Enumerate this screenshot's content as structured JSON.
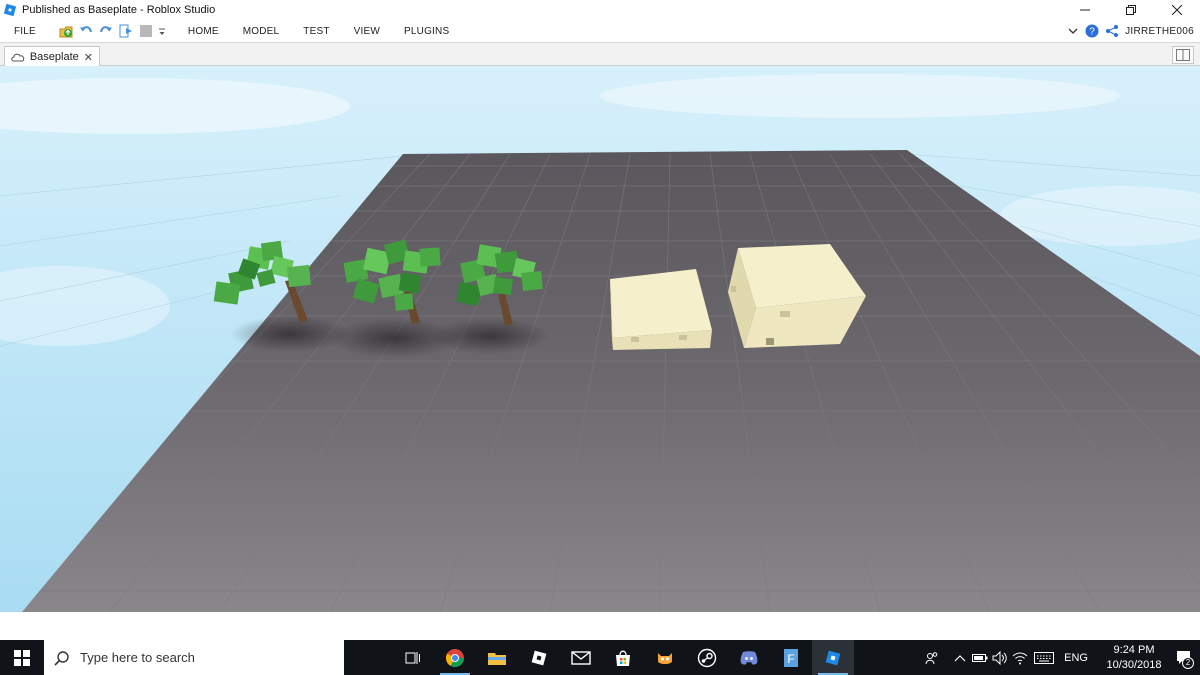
{
  "window": {
    "title": "Published as Baseplate - Roblox Studio",
    "controls": [
      "minimize-icon",
      "restore-icon",
      "close-icon"
    ]
  },
  "menu": {
    "file_label": "FILE",
    "tabs": [
      "HOME",
      "MODEL",
      "TEST",
      "VIEW",
      "PLUGINS"
    ],
    "username": "JIRRETHE006"
  },
  "document": {
    "tab_label": "Baseplate",
    "close_glyph": "✕"
  },
  "scene": {
    "objects": [
      "tree",
      "tree",
      "tree",
      "building",
      "building"
    ],
    "colors": {
      "sky": "#bfe6f7",
      "baseplate": "#6f6c70",
      "foliage": "#4aa845",
      "trunk": "#6a4a2f",
      "building": "#f4ecc4"
    }
  },
  "taskbar": {
    "search_placeholder": "Type here to search",
    "apps": [
      "task-view-icon",
      "chrome-icon",
      "file-explorer-icon",
      "roblox-icon",
      "mail-icon",
      "store-icon",
      "scratch-cat-icon",
      "steam-icon",
      "discord-icon",
      "paint-icon",
      "roblox-studio-icon"
    ],
    "language": "ENG",
    "time": "9:24 PM",
    "date": "10/30/2018",
    "notification_count": "2"
  }
}
